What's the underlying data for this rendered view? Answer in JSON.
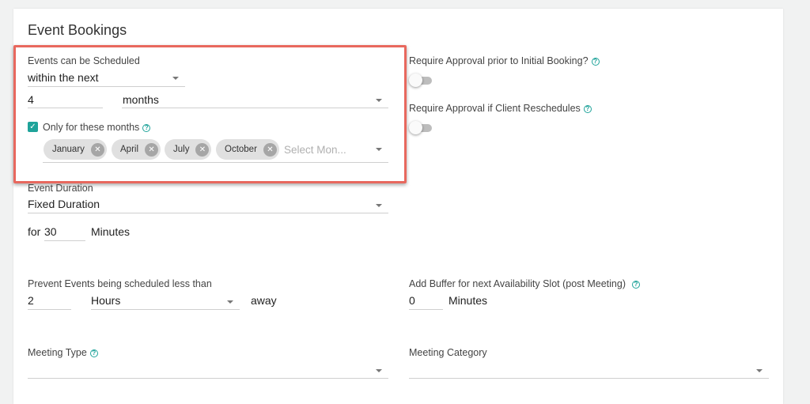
{
  "title": "Event Bookings",
  "schedule": {
    "label": "Events can be Scheduled",
    "mode": "within the next",
    "amount": "4",
    "unit": "months",
    "months_only_label": "Only for these months",
    "months_only_checked": true,
    "selected_months": [
      "January",
      "April",
      "July",
      "October"
    ],
    "months_placeholder": "Select Mon..."
  },
  "approval": {
    "initial_label": "Require Approval prior to Initial Booking?",
    "initial_on": false,
    "reschedule_label": "Require Approval if Client Reschedules",
    "reschedule_on": false
  },
  "duration": {
    "label": "Event Duration",
    "type": "Fixed Duration",
    "for_label": "for",
    "minutes_value": "30",
    "minutes_label": "Minutes"
  },
  "prevent": {
    "label": "Prevent Events being scheduled less than",
    "value": "2",
    "unit": "Hours",
    "suffix": "away"
  },
  "buffer": {
    "label": "Add Buffer for next Availability Slot (post Meeting)",
    "value": "0",
    "unit": "Minutes"
  },
  "meeting_type": {
    "label": "Meeting Type",
    "value": ""
  },
  "meeting_category": {
    "label": "Meeting Category",
    "value": ""
  },
  "colors": {
    "accent": "#1fa39a",
    "highlight": "#e8685e",
    "chip": "#e0e0e0"
  },
  "icons": {
    "help": "help-circle-icon",
    "remove": "close-circle-icon",
    "dropdown": "caret-down-icon",
    "check": "check-icon"
  }
}
